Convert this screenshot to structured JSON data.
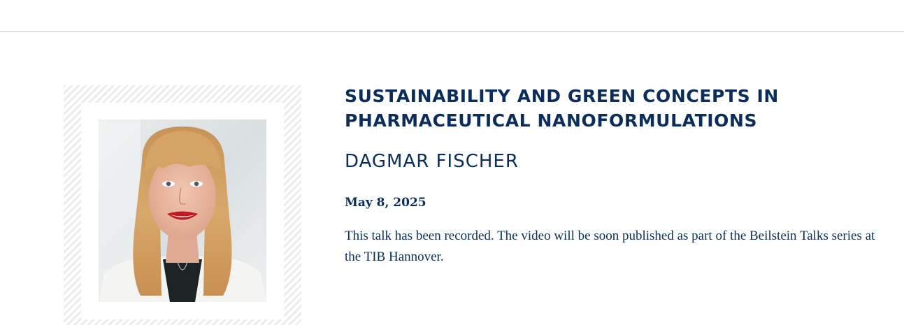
{
  "talk": {
    "title": "SUSTAINABILITY AND GREEN CONCEPTS IN PHARMACEUTICAL NANOFORMULATIONS",
    "speaker": "DAGMAR FISCHER",
    "date": "May 8, 2025",
    "description": "This talk has been recorded. The video will be soon published as part of the Beilstein Talks series at the TIB Hannover."
  },
  "colors": {
    "text": "#0a2d5e",
    "divider": "#c4c4c4",
    "frame_stripe": "#ececec"
  }
}
